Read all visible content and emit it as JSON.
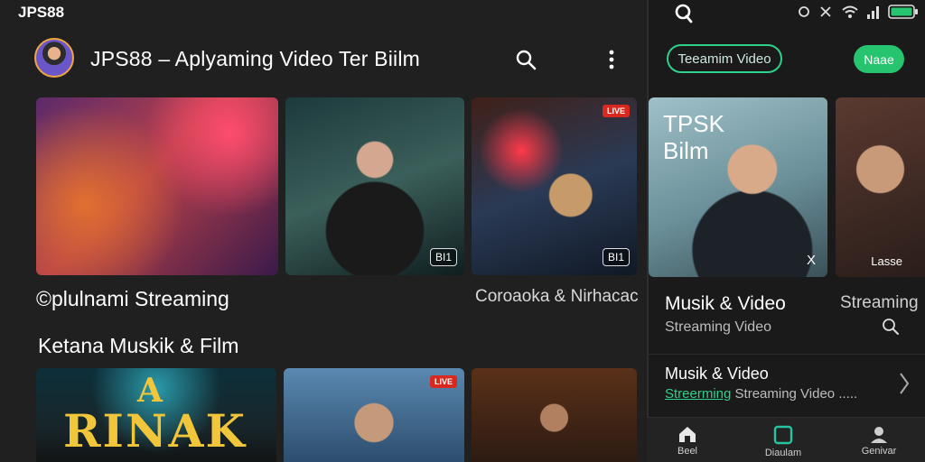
{
  "status_bar": {
    "app_name": "JPS88"
  },
  "header": {
    "title": "JPS88 – Aplyaming Video Ter Biilm"
  },
  "row1": {
    "thumbs": [
      {
        "badge": ""
      },
      {
        "badge": "BI1"
      },
      {
        "badge": "BI1",
        "live": "LIVE"
      }
    ],
    "caption_left": "©plulnami  Streaming",
    "caption_right": "Coroaoka & Nirhacac"
  },
  "section": {
    "title": "Ketana Muskik & Film"
  },
  "row2": {
    "poster_top": "A",
    "poster_text": "RINAK",
    "live_badge": "LIVE"
  },
  "right_panel": {
    "pill_label": "Teeamim Video",
    "green_button": "Naae",
    "feature": {
      "overlay_title_line1": "TPSK",
      "overlay_title_line2": "Bilm",
      "badge": "X",
      "title": "Musik & Video",
      "subtitle": "Streaming Video"
    },
    "side_card": {
      "badge": "Lasse",
      "title": "Streaming"
    },
    "list_item": {
      "title": "Musik & Video",
      "sub_green": "Streerming",
      "sub_rest": " Streaming Video ....."
    },
    "nav": [
      {
        "label": "Beel",
        "icon": "home-icon"
      },
      {
        "label": "Diaulam",
        "icon": "square-icon"
      },
      {
        "label": "Genivar",
        "icon": "profile-icon"
      }
    ]
  },
  "colors": {
    "accent_green": "#26c46f",
    "live_red": "#d9281e",
    "background": "#1f1f1f"
  }
}
